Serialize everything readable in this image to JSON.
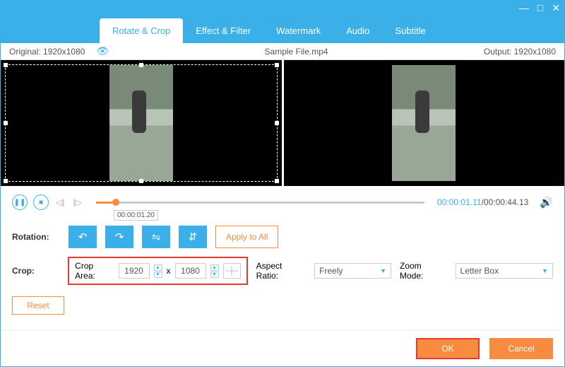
{
  "titlebar": {
    "min": "—",
    "max": "□",
    "close": "✕"
  },
  "tabs": {
    "rotate": "Rotate & Crop",
    "effect": "Effect & Filter",
    "watermark": "Watermark",
    "audio": "Audio",
    "subtitle": "Subtitle"
  },
  "infobar": {
    "original_label": "Original:",
    "original_value": "1920x1080",
    "filename": "Sample File.mp4",
    "output_label": "Output:",
    "output_value": "1920x1080"
  },
  "playback": {
    "tooltip": "00:00:01.20",
    "current": "00:00:01.11",
    "sep": "/",
    "duration": "00:00:44.13"
  },
  "rotation": {
    "label": "Rotation:",
    "apply_all": "Apply to All"
  },
  "crop": {
    "label": "Crop:",
    "area_label": "Crop Area:",
    "width": "1920",
    "sep": "x",
    "height": "1080",
    "aspect_label": "Aspect Ratio:",
    "aspect_value": "Freely",
    "zoom_label": "Zoom Mode:",
    "zoom_value": "Letter Box",
    "reset": "Reset"
  },
  "footer": {
    "ok": "OK",
    "cancel": "Cancel"
  }
}
